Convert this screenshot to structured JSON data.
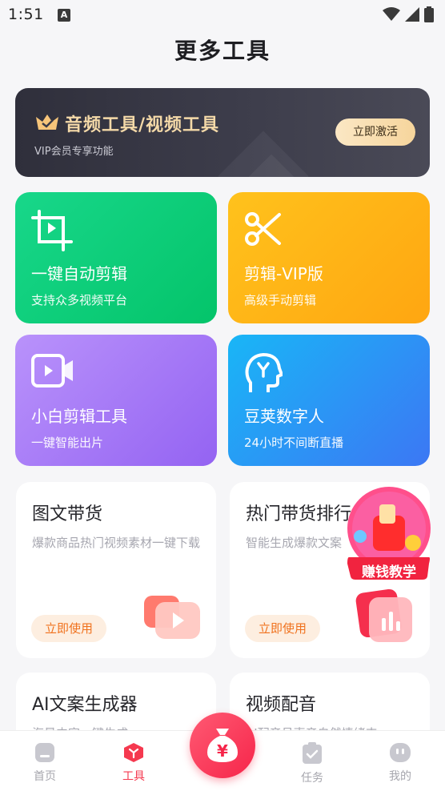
{
  "status": {
    "time": "1:51",
    "notif_glyph": "A"
  },
  "page": {
    "title": "更多工具"
  },
  "banner": {
    "title": "音频工具/视频工具",
    "subtitle": "VIP会员专享功能",
    "button": "立即激活"
  },
  "tiles": [
    {
      "title": "一键自动剪辑",
      "subtitle": "支持众多视频平台",
      "icon": "crop-play-icon"
    },
    {
      "title": "剪辑-VIP版",
      "subtitle": "高级手动剪辑",
      "icon": "scissors-icon"
    },
    {
      "title": "小白剪辑工具",
      "subtitle": "一键智能出片",
      "icon": "video-camera-icon"
    },
    {
      "title": "豆荚数字人",
      "subtitle": "24小时不间断直播",
      "icon": "digital-human-icon"
    }
  ],
  "cards": [
    {
      "title": "图文带货",
      "desc": "爆款商品热门视频素材一键下载",
      "button": "立即使用"
    },
    {
      "title": "热门带货排行",
      "desc": "智能生成爆款文案",
      "button": "立即使用"
    },
    {
      "title": "AI文案生成器",
      "desc": "海量内容一键生成"
    },
    {
      "title": "视频配音",
      "desc": "AI配音员声音自然情绪丰"
    }
  ],
  "promo": {
    "label": "赚钱教学"
  },
  "tabbar": {
    "items": [
      {
        "label": "首页"
      },
      {
        "label": "工具"
      },
      {
        "label": "任务"
      },
      {
        "label": "我的"
      }
    ],
    "center_glyph": "¥"
  },
  "colors": {
    "active": "#f5394f",
    "banner_text": "#f4d9a8",
    "use_text": "#f0721e"
  }
}
